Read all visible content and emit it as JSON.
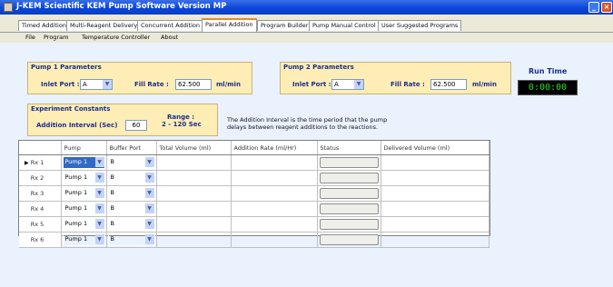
{
  "window": {
    "title": "J-KEM Scientific KEM Pump Software   Version MP",
    "minimize_label": "_",
    "close_label": "×"
  },
  "tabs": [
    {
      "label": "Timed Addition"
    },
    {
      "label": "Multi-Reagent Delivery"
    },
    {
      "label": "Concurrent Addition"
    },
    {
      "label": "Parallel Addition"
    },
    {
      "label": "Program Builder"
    },
    {
      "label": "Pump Manual Control"
    },
    {
      "label": "User Suggested Programs"
    }
  ],
  "active_tab": "Parallel Addition",
  "menu": [
    {
      "label": "File"
    },
    {
      "label": "Program"
    },
    {
      "label": "Temperature Controller"
    },
    {
      "label": "About"
    }
  ],
  "pump1": {
    "title": "Pump 1 Parameters",
    "inlet_label": "Inlet Port :",
    "inlet_value": "A",
    "fill_label": "Fill Rate :",
    "fill_value": "62.500",
    "fill_unit": "ml/min"
  },
  "pump2": {
    "title": "Pump 2 Parameters",
    "inlet_label": "Inlet Port :",
    "inlet_value": "A",
    "fill_label": "Fill Rate :",
    "fill_value": "62.500",
    "fill_unit": "ml/min"
  },
  "runtime": {
    "label": "Run Time",
    "value": "0:00:00"
  },
  "experiment": {
    "title": "Experiment Constants",
    "interval_label": "Addition Interval (Sec)",
    "interval_value": "60",
    "range_label": "Range :",
    "range_value": "2 - 120 Sec",
    "info": "The Addition Interval is the time period that the pump delays between reagent additions to the reactions."
  },
  "grid": {
    "columns": [
      "Pump",
      "Buffer Port",
      "Total Volume (ml)",
      "Addition Rate (ml/Hr)",
      "Status",
      "Delivered Volume (ml)"
    ],
    "rows": [
      {
        "name": "Rx 1",
        "pump": "Pump 1",
        "port": "B",
        "total": "",
        "rate": "",
        "delivered": ""
      },
      {
        "name": "Rx 2",
        "pump": "Pump 1",
        "port": "B",
        "total": "",
        "rate": "",
        "delivered": ""
      },
      {
        "name": "Rx 3",
        "pump": "Pump 1",
        "port": "B",
        "total": "",
        "rate": "",
        "delivered": ""
      },
      {
        "name": "Rx 4",
        "pump": "Pump 1",
        "port": "B",
        "total": "",
        "rate": "",
        "delivered": ""
      },
      {
        "name": "Rx 5",
        "pump": "Pump 1",
        "port": "B",
        "total": "",
        "rate": "",
        "delivered": ""
      },
      {
        "name": "Rx 6",
        "pump": "Pump 1",
        "port": "B",
        "total": "",
        "rate": "",
        "delivered": ""
      }
    ],
    "current_row_marker": "▶",
    "dropdown_arrow": "▼"
  },
  "colors": {
    "titlebar": "#0a46d8",
    "group_background": "#ffedb6",
    "group_title": "#1a2f8a",
    "content_background": "#eaf2fe",
    "runtime_digits": "#19e51c",
    "selection": "#316ac5"
  }
}
